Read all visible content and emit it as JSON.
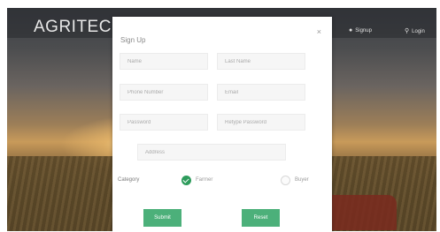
{
  "navbar": {
    "brand": "AGRITECH",
    "items": [
      {
        "icon": "person-icon",
        "label": "Signup"
      },
      {
        "icon": "key-icon",
        "label": "Login"
      }
    ]
  },
  "hero": {
    "tagline_left": "",
    "tagline_right": ""
  },
  "modal": {
    "title": "Sign Up",
    "close_label": "×",
    "fields": {
      "first_name": {
        "placeholder": "Name",
        "value": ""
      },
      "last_name": {
        "placeholder": "Last Name",
        "value": ""
      },
      "phone": {
        "placeholder": "Phone Number",
        "value": ""
      },
      "email": {
        "placeholder": "Email",
        "value": ""
      },
      "password": {
        "placeholder": "Password",
        "value": ""
      },
      "confirm_password": {
        "placeholder": "Retype Password",
        "value": ""
      },
      "address": {
        "placeholder": "Address",
        "value": ""
      }
    },
    "category_label": "Category",
    "categories": [
      {
        "label": "Farmer",
        "selected": true
      },
      {
        "label": "Buyer",
        "selected": false
      }
    ],
    "submit_label": "Submit",
    "reset_label": "Reset"
  },
  "colors": {
    "accent": "#4cb07a",
    "radio_selected": "#2e9c5c"
  }
}
